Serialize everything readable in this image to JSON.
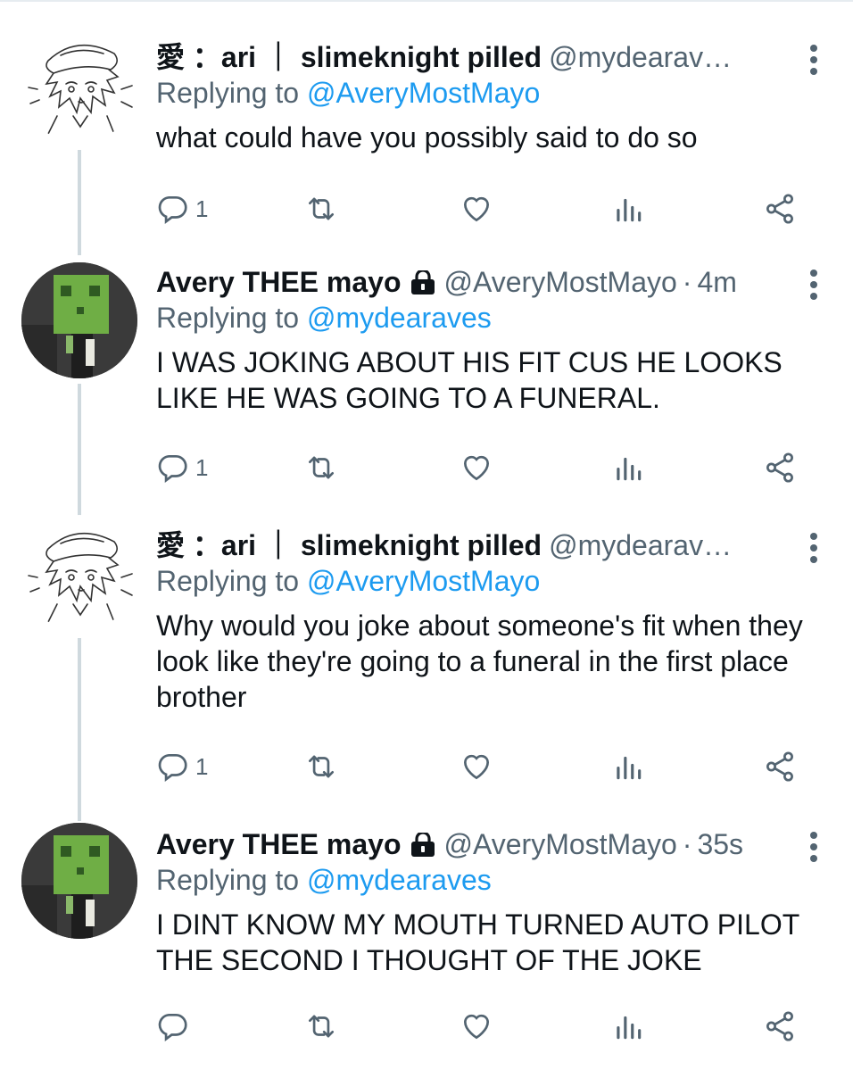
{
  "tweets": [
    {
      "author": "愛 ：ari ｜ slimeknight pilled",
      "handle": "@mydearav…",
      "time": "",
      "reply_label": "Replying to",
      "reply_to": "@AveryMostMayo",
      "text": "what could have you possibly said to do so",
      "reply_count": "1",
      "locked": false,
      "avatar": "anime-sketch-avatar"
    },
    {
      "author": "Avery THEE mayo",
      "handle": "@AveryMostMayo",
      "time": "4m",
      "reply_label": "Replying to",
      "reply_to": "@mydearaves",
      "text": "I WAS JOKING ABOUT HIS FIT CUS HE LOOKS LIKE HE WAS GOING TO A FUNERAL.",
      "reply_count": "1",
      "locked": true,
      "avatar": "slime-avatar"
    },
    {
      "author": "愛 ：ari ｜ slimeknight pilled",
      "handle": "@mydearav…",
      "time": "",
      "reply_label": "Replying to",
      "reply_to": "@AveryMostMayo",
      "text": "Why would you joke about someone's fit when they look like they're going to a funeral in the first place brother",
      "reply_count": "1",
      "locked": false,
      "avatar": "anime-sketch-avatar"
    },
    {
      "author": "Avery THEE mayo",
      "handle": "@AveryMostMayo",
      "time": "35s",
      "reply_label": "Replying to",
      "reply_to": "@mydearaves",
      "text": "I DINT KNOW MY MOUTH TURNED AUTO PILOT THE SECOND I THOUGHT OF THE JOKE",
      "reply_count": "",
      "locked": true,
      "avatar": "slime-avatar"
    }
  ],
  "icons": {
    "reply": "reply-icon",
    "retweet": "retweet-icon",
    "like": "heart-icon",
    "views": "views-icon",
    "share": "share-icon",
    "more": "more-vertical-icon",
    "lock": "lock-icon"
  },
  "colors": {
    "link": "#1d9bf0",
    "secondary_text": "#536471",
    "primary_text": "#0f1419",
    "slime_green": "#6fae45",
    "thread_line": "#cfd9de"
  }
}
